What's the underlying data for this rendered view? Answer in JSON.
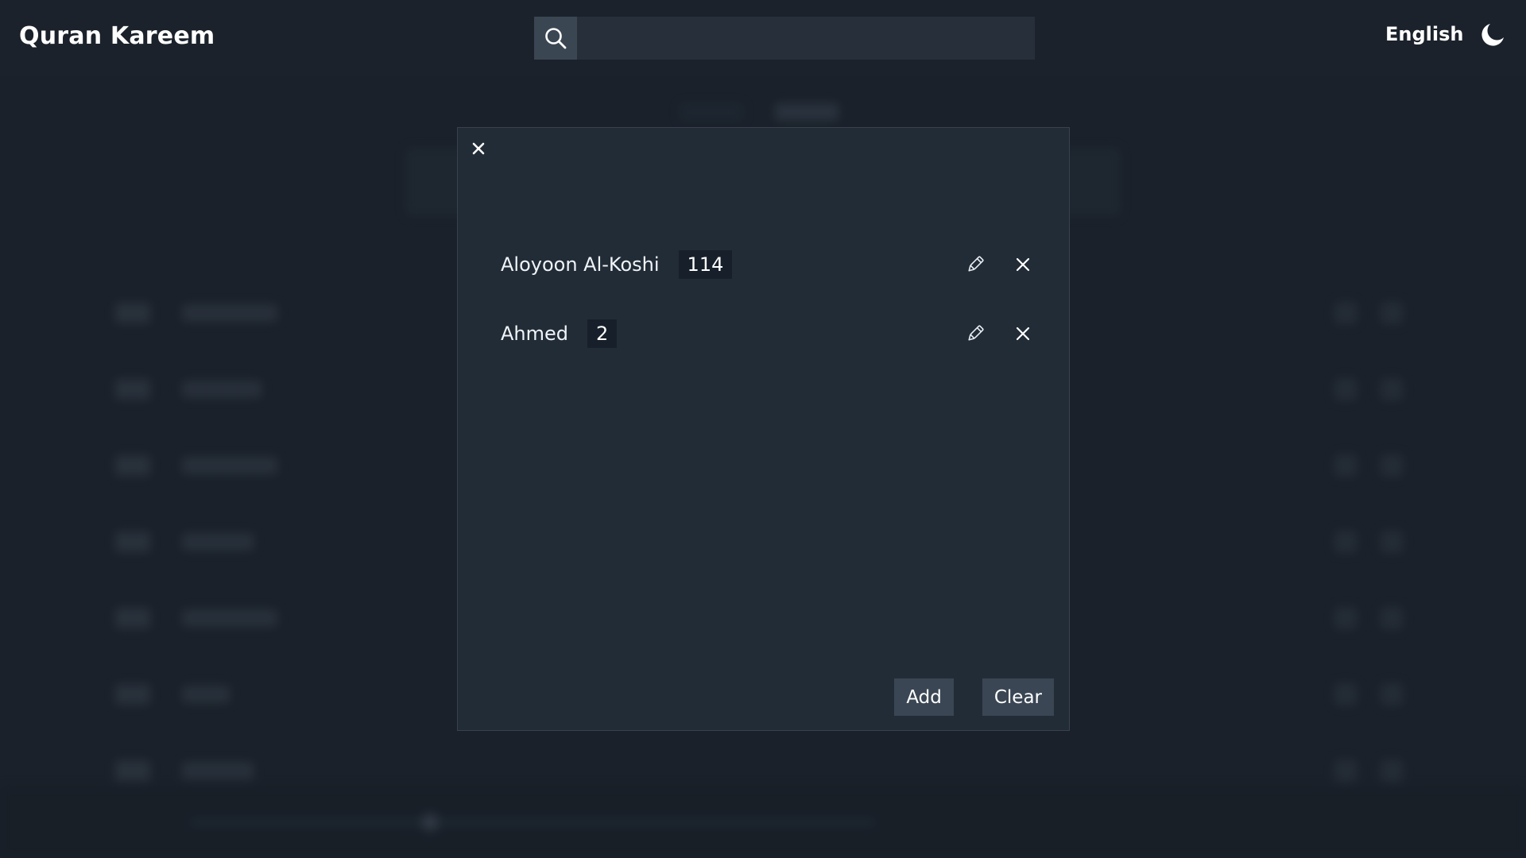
{
  "header": {
    "app_title": "Quran Kareem",
    "search_placeholder": "",
    "language": "English",
    "icons": {
      "search": "search-icon",
      "theme": "moon-icon"
    }
  },
  "modal": {
    "close_icon": "close-icon",
    "items": [
      {
        "name": "Aloyoon Al-Koshi",
        "count": "114"
      },
      {
        "name": "Ahmed",
        "count": "2"
      }
    ],
    "item_icons": {
      "edit": "pencil-icon",
      "remove": "close-icon"
    },
    "buttons": {
      "add": "Add",
      "clear": "Clear"
    }
  },
  "colors": {
    "background": "#1e252e",
    "header": "#1b222b",
    "modal": "#222c37",
    "button": "#3a4653"
  }
}
